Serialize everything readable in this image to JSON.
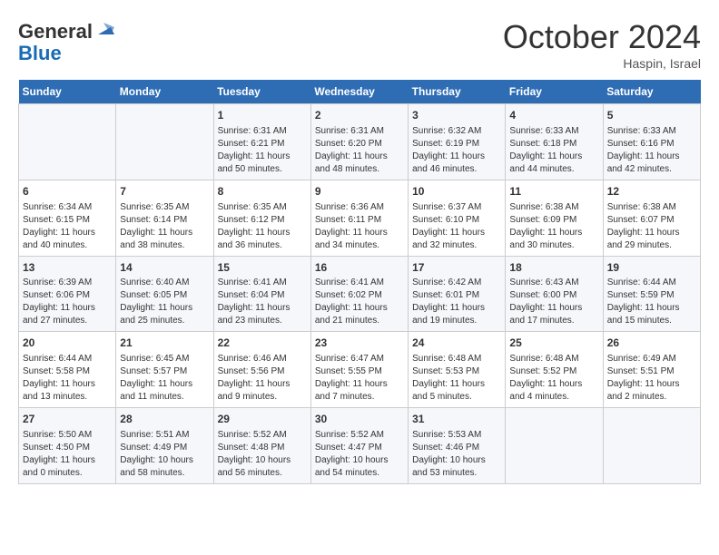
{
  "header": {
    "logo_line1": "General",
    "logo_line2": "Blue",
    "month_title": "October 2024",
    "location": "Haspin, Israel"
  },
  "days_of_week": [
    "Sunday",
    "Monday",
    "Tuesday",
    "Wednesday",
    "Thursday",
    "Friday",
    "Saturday"
  ],
  "weeks": [
    [
      {
        "day": "",
        "sunrise": "",
        "sunset": "",
        "daylight": ""
      },
      {
        "day": "",
        "sunrise": "",
        "sunset": "",
        "daylight": ""
      },
      {
        "day": "1",
        "sunrise": "Sunrise: 6:31 AM",
        "sunset": "Sunset: 6:21 PM",
        "daylight": "Daylight: 11 hours and 50 minutes."
      },
      {
        "day": "2",
        "sunrise": "Sunrise: 6:31 AM",
        "sunset": "Sunset: 6:20 PM",
        "daylight": "Daylight: 11 hours and 48 minutes."
      },
      {
        "day": "3",
        "sunrise": "Sunrise: 6:32 AM",
        "sunset": "Sunset: 6:19 PM",
        "daylight": "Daylight: 11 hours and 46 minutes."
      },
      {
        "day": "4",
        "sunrise": "Sunrise: 6:33 AM",
        "sunset": "Sunset: 6:18 PM",
        "daylight": "Daylight: 11 hours and 44 minutes."
      },
      {
        "day": "5",
        "sunrise": "Sunrise: 6:33 AM",
        "sunset": "Sunset: 6:16 PM",
        "daylight": "Daylight: 11 hours and 42 minutes."
      }
    ],
    [
      {
        "day": "6",
        "sunrise": "Sunrise: 6:34 AM",
        "sunset": "Sunset: 6:15 PM",
        "daylight": "Daylight: 11 hours and 40 minutes."
      },
      {
        "day": "7",
        "sunrise": "Sunrise: 6:35 AM",
        "sunset": "Sunset: 6:14 PM",
        "daylight": "Daylight: 11 hours and 38 minutes."
      },
      {
        "day": "8",
        "sunrise": "Sunrise: 6:35 AM",
        "sunset": "Sunset: 6:12 PM",
        "daylight": "Daylight: 11 hours and 36 minutes."
      },
      {
        "day": "9",
        "sunrise": "Sunrise: 6:36 AM",
        "sunset": "Sunset: 6:11 PM",
        "daylight": "Daylight: 11 hours and 34 minutes."
      },
      {
        "day": "10",
        "sunrise": "Sunrise: 6:37 AM",
        "sunset": "Sunset: 6:10 PM",
        "daylight": "Daylight: 11 hours and 32 minutes."
      },
      {
        "day": "11",
        "sunrise": "Sunrise: 6:38 AM",
        "sunset": "Sunset: 6:09 PM",
        "daylight": "Daylight: 11 hours and 30 minutes."
      },
      {
        "day": "12",
        "sunrise": "Sunrise: 6:38 AM",
        "sunset": "Sunset: 6:07 PM",
        "daylight": "Daylight: 11 hours and 29 minutes."
      }
    ],
    [
      {
        "day": "13",
        "sunrise": "Sunrise: 6:39 AM",
        "sunset": "Sunset: 6:06 PM",
        "daylight": "Daylight: 11 hours and 27 minutes."
      },
      {
        "day": "14",
        "sunrise": "Sunrise: 6:40 AM",
        "sunset": "Sunset: 6:05 PM",
        "daylight": "Daylight: 11 hours and 25 minutes."
      },
      {
        "day": "15",
        "sunrise": "Sunrise: 6:41 AM",
        "sunset": "Sunset: 6:04 PM",
        "daylight": "Daylight: 11 hours and 23 minutes."
      },
      {
        "day": "16",
        "sunrise": "Sunrise: 6:41 AM",
        "sunset": "Sunset: 6:02 PM",
        "daylight": "Daylight: 11 hours and 21 minutes."
      },
      {
        "day": "17",
        "sunrise": "Sunrise: 6:42 AM",
        "sunset": "Sunset: 6:01 PM",
        "daylight": "Daylight: 11 hours and 19 minutes."
      },
      {
        "day": "18",
        "sunrise": "Sunrise: 6:43 AM",
        "sunset": "Sunset: 6:00 PM",
        "daylight": "Daylight: 11 hours and 17 minutes."
      },
      {
        "day": "19",
        "sunrise": "Sunrise: 6:44 AM",
        "sunset": "Sunset: 5:59 PM",
        "daylight": "Daylight: 11 hours and 15 minutes."
      }
    ],
    [
      {
        "day": "20",
        "sunrise": "Sunrise: 6:44 AM",
        "sunset": "Sunset: 5:58 PM",
        "daylight": "Daylight: 11 hours and 13 minutes."
      },
      {
        "day": "21",
        "sunrise": "Sunrise: 6:45 AM",
        "sunset": "Sunset: 5:57 PM",
        "daylight": "Daylight: 11 hours and 11 minutes."
      },
      {
        "day": "22",
        "sunrise": "Sunrise: 6:46 AM",
        "sunset": "Sunset: 5:56 PM",
        "daylight": "Daylight: 11 hours and 9 minutes."
      },
      {
        "day": "23",
        "sunrise": "Sunrise: 6:47 AM",
        "sunset": "Sunset: 5:55 PM",
        "daylight": "Daylight: 11 hours and 7 minutes."
      },
      {
        "day": "24",
        "sunrise": "Sunrise: 6:48 AM",
        "sunset": "Sunset: 5:53 PM",
        "daylight": "Daylight: 11 hours and 5 minutes."
      },
      {
        "day": "25",
        "sunrise": "Sunrise: 6:48 AM",
        "sunset": "Sunset: 5:52 PM",
        "daylight": "Daylight: 11 hours and 4 minutes."
      },
      {
        "day": "26",
        "sunrise": "Sunrise: 6:49 AM",
        "sunset": "Sunset: 5:51 PM",
        "daylight": "Daylight: 11 hours and 2 minutes."
      }
    ],
    [
      {
        "day": "27",
        "sunrise": "Sunrise: 5:50 AM",
        "sunset": "Sunset: 4:50 PM",
        "daylight": "Daylight: 11 hours and 0 minutes."
      },
      {
        "day": "28",
        "sunrise": "Sunrise: 5:51 AM",
        "sunset": "Sunset: 4:49 PM",
        "daylight": "Daylight: 10 hours and 58 minutes."
      },
      {
        "day": "29",
        "sunrise": "Sunrise: 5:52 AM",
        "sunset": "Sunset: 4:48 PM",
        "daylight": "Daylight: 10 hours and 56 minutes."
      },
      {
        "day": "30",
        "sunrise": "Sunrise: 5:52 AM",
        "sunset": "Sunset: 4:47 PM",
        "daylight": "Daylight: 10 hours and 54 minutes."
      },
      {
        "day": "31",
        "sunrise": "Sunrise: 5:53 AM",
        "sunset": "Sunset: 4:46 PM",
        "daylight": "Daylight: 10 hours and 53 minutes."
      },
      {
        "day": "",
        "sunrise": "",
        "sunset": "",
        "daylight": ""
      },
      {
        "day": "",
        "sunrise": "",
        "sunset": "",
        "daylight": ""
      }
    ]
  ]
}
